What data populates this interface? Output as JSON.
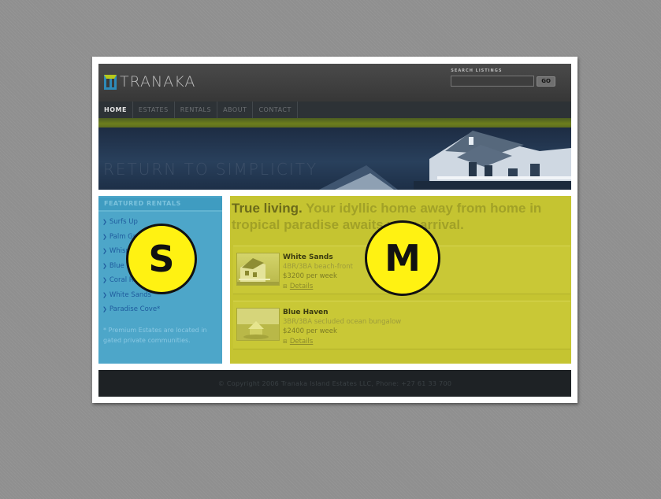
{
  "site": {
    "logo_text": "TRANAKA",
    "search": {
      "label": "SEARCH LISTINGS",
      "placeholder": "",
      "button": "GO"
    }
  },
  "nav": {
    "items": [
      "HOME",
      "ESTATES",
      "RENTALS",
      "ABOUT",
      "CONTACT"
    ],
    "active": "HOME"
  },
  "hero": {
    "tagline": "RETURN TO SIMPLICITY"
  },
  "sidebar": {
    "heading": "FEATURED RENTALS",
    "items": [
      "Surfs Up",
      "Palm Grove",
      "Whispering Pines",
      "Blue Haven",
      "Coral Reef",
      "White Sands",
      "Paradise Cove*"
    ],
    "note": "* Premium Estates are located in gated private communities."
  },
  "main": {
    "headline_lead": "True living.",
    "headline_rest": " Your idyllic home away from home in tropical paradise awaits your arrival.",
    "listings": [
      {
        "name": "White Sands",
        "desc": "4BR/3BA beach-front",
        "price": "$3200 per week",
        "details": "Details"
      },
      {
        "name": "Blue Haven",
        "desc": "3BR/3BA secluded ocean bungalow",
        "price": "$2400 per week",
        "details": "Details"
      }
    ]
  },
  "footer": {
    "text": "© Copyright 2006 Tranaka Island Estates LLC, Phone: +27 61 33 700"
  },
  "markers": {
    "sidebar": "S",
    "main": "M"
  },
  "colors": {
    "sidebar_overlay": "#4da6c9",
    "main_overlay": "#c5c431",
    "marker_fill": "#fff212",
    "logo_blue": "#2e8ab8",
    "logo_green": "#b7c91b"
  },
  "icons": {
    "list_bullet": "arrow-right-icon",
    "details": "plus-box-icon"
  }
}
